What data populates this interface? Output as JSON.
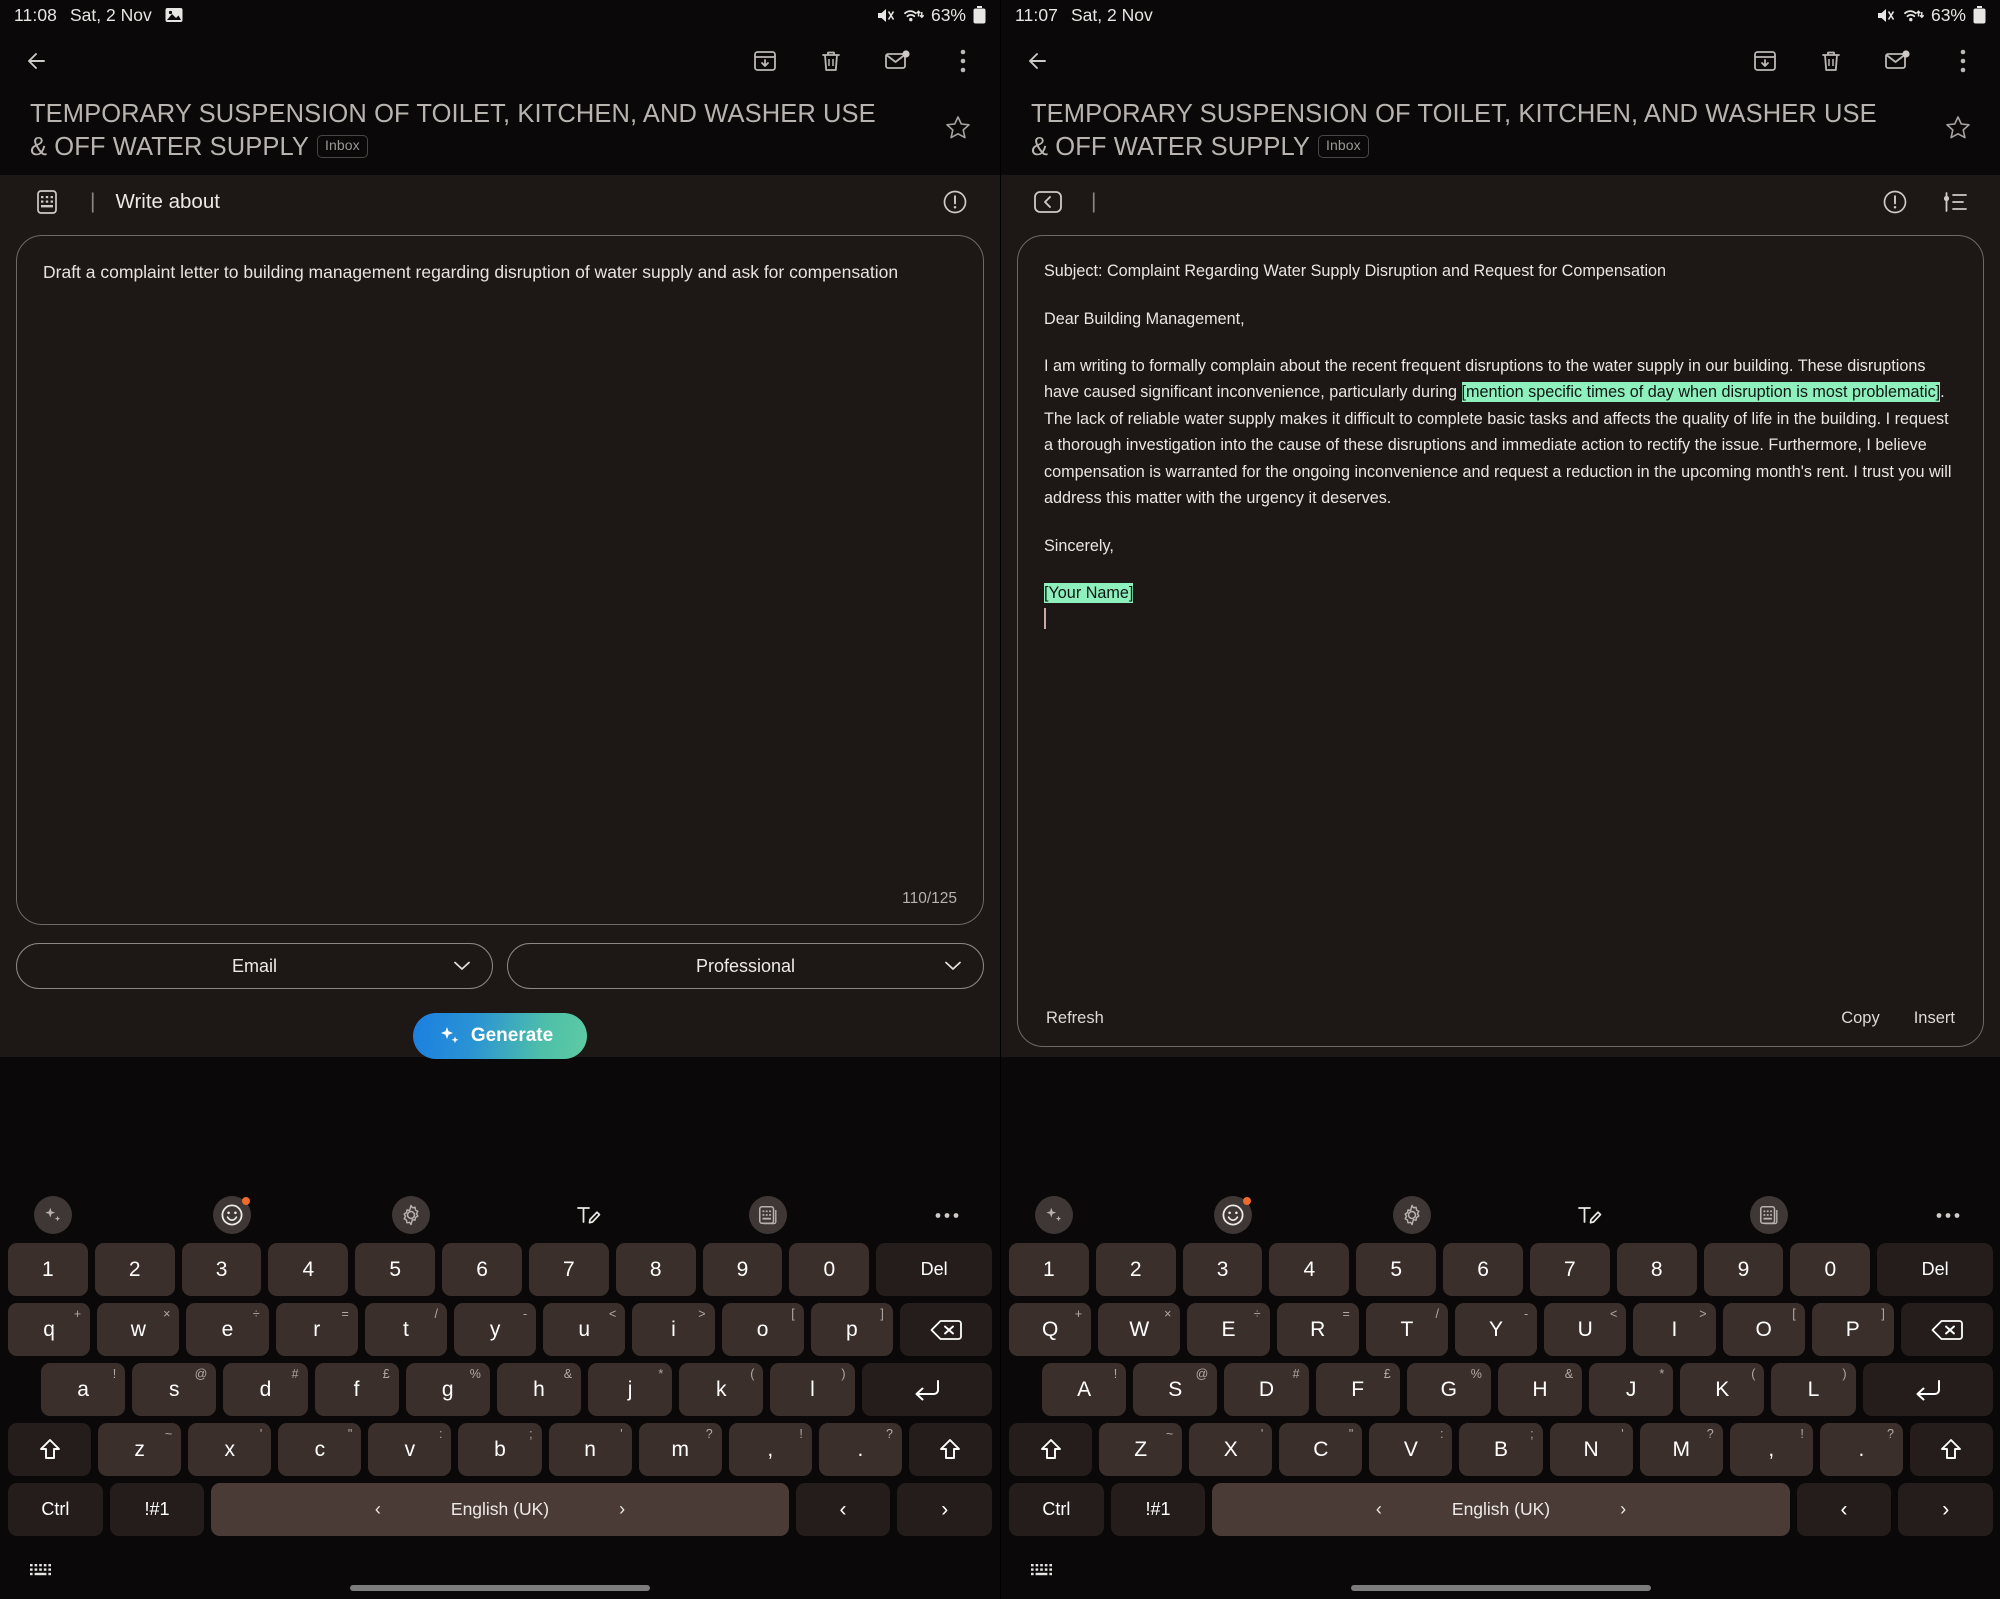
{
  "left": {
    "status": {
      "time": "11:08",
      "date": "Sat, 2 Nov",
      "battery": "63%"
    },
    "subject": "TEMPORARY SUSPENSION OF TOILET, KITCHEN, AND WASHER USE & OFF WATER SUPPLY",
    "label_chip": "Inbox",
    "ai": {
      "title": "Write about",
      "separator": "|",
      "prompt": "Draft a complaint letter to building management regarding disruption of water supply and ask for compensation",
      "counter": "110/125",
      "format_select": "Email",
      "tone_select": "Professional",
      "generate_label": "Generate"
    }
  },
  "right": {
    "status": {
      "time": "11:07",
      "date": "Sat, 2 Nov",
      "battery": "63%"
    },
    "subject": "TEMPORARY SUSPENSION OF TOILET, KITCHEN, AND WASHER USE & OFF WATER SUPPLY",
    "label_chip": "Inbox",
    "ai": {
      "separator": "|"
    },
    "result": {
      "subject_line": "Subject: Complaint Regarding Water Supply Disruption and Request for Compensation",
      "greeting": "Dear Building Management,",
      "body_part1": "I am writing to formally complain about the recent frequent disruptions to the water supply in our building. These disruptions have caused significant inconvenience, particularly during ",
      "body_highlight1": "[mention specific times of day when disruption is most problematic]",
      "body_part2": ".  The lack of reliable water supply makes it difficult to complete basic tasks and affects the quality of life in the building. I request a thorough investigation into the cause of these disruptions and immediate action to rectify the issue. Furthermore, I believe compensation is warranted for the ongoing inconvenience and request a reduction in the upcoming month's rent. I trust you will address this matter with the urgency it deserves.",
      "signoff": "Sincerely,",
      "signature_highlight": "[Your Name]",
      "refresh_label": "Refresh",
      "copy_label": "Copy",
      "insert_label": "Insert"
    }
  },
  "keyboard": {
    "row_numbers": [
      {
        "label": "1"
      },
      {
        "label": "2"
      },
      {
        "label": "3"
      },
      {
        "label": "4"
      },
      {
        "label": "5"
      },
      {
        "label": "6"
      },
      {
        "label": "7"
      },
      {
        "label": "8"
      },
      {
        "label": "9"
      },
      {
        "label": "0"
      }
    ],
    "del_label": "Del",
    "row_top_lower": [
      {
        "label": "q",
        "sup": "+"
      },
      {
        "label": "w",
        "sup": "×"
      },
      {
        "label": "e",
        "sup": "÷"
      },
      {
        "label": "r",
        "sup": "="
      },
      {
        "label": "t",
        "sup": "/"
      },
      {
        "label": "y",
        "sup": "-"
      },
      {
        "label": "u",
        "sup": "<"
      },
      {
        "label": "i",
        "sup": ">"
      },
      {
        "label": "o",
        "sup": "["
      },
      {
        "label": "p",
        "sup": "]"
      }
    ],
    "row_top_upper": [
      {
        "label": "Q",
        "sup": "+"
      },
      {
        "label": "W",
        "sup": "×"
      },
      {
        "label": "E",
        "sup": "÷"
      },
      {
        "label": "R",
        "sup": "="
      },
      {
        "label": "T",
        "sup": "/"
      },
      {
        "label": "Y",
        "sup": "-"
      },
      {
        "label": "U",
        "sup": "<"
      },
      {
        "label": "I",
        "sup": ">"
      },
      {
        "label": "O",
        "sup": "["
      },
      {
        "label": "P",
        "sup": "]"
      }
    ],
    "row_home_lower": [
      {
        "label": "a",
        "sup": "!"
      },
      {
        "label": "s",
        "sup": "@"
      },
      {
        "label": "d",
        "sup": "#"
      },
      {
        "label": "f",
        "sup": "£"
      },
      {
        "label": "g",
        "sup": "%"
      },
      {
        "label": "h",
        "sup": "&"
      },
      {
        "label": "j",
        "sup": "*"
      },
      {
        "label": "k",
        "sup": "("
      },
      {
        "label": "l",
        "sup": ")"
      }
    ],
    "row_home_upper": [
      {
        "label": "A",
        "sup": "!"
      },
      {
        "label": "S",
        "sup": "@"
      },
      {
        "label": "D",
        "sup": "#"
      },
      {
        "label": "F",
        "sup": "£"
      },
      {
        "label": "G",
        "sup": "%"
      },
      {
        "label": "H",
        "sup": "&"
      },
      {
        "label": "J",
        "sup": "*"
      },
      {
        "label": "K",
        "sup": "("
      },
      {
        "label": "L",
        "sup": ")"
      }
    ],
    "row_bottom_lower": [
      {
        "label": "z",
        "sup": "~"
      },
      {
        "label": "x",
        "sup": "'"
      },
      {
        "label": "c",
        "sup": "\""
      },
      {
        "label": "v",
        "sup": ":"
      },
      {
        "label": "b",
        "sup": ";"
      },
      {
        "label": "n",
        "sup": "'"
      },
      {
        "label": "m",
        "sup": "?"
      },
      {
        "label": ",",
        "sup": "!"
      },
      {
        "label": ".",
        "sup": "?"
      }
    ],
    "row_bottom_upper": [
      {
        "label": "Z",
        "sup": "~"
      },
      {
        "label": "X",
        "sup": "'"
      },
      {
        "label": "C",
        "sup": "\""
      },
      {
        "label": "V",
        "sup": ":"
      },
      {
        "label": "B",
        "sup": ";"
      },
      {
        "label": "N",
        "sup": "'"
      },
      {
        "label": "M",
        "sup": "?"
      },
      {
        "label": ",",
        "sup": "!"
      },
      {
        "label": ".",
        "sup": "?"
      }
    ],
    "ctrl_label": "Ctrl",
    "symbols_label": "!#1",
    "language_label": "English (UK)",
    "prev_arrow": "‹",
    "next_arrow": "›"
  },
  "colors": {
    "highlight": "#8ef0bd",
    "generate_gradient_start": "#1a7fe0",
    "generate_gradient_end": "#5ecba4",
    "key_bg": "#3b2f2b",
    "space_bg": "#4a3b37",
    "panel_bg": "#1d1715",
    "notify_dot": "#f06a2a"
  }
}
